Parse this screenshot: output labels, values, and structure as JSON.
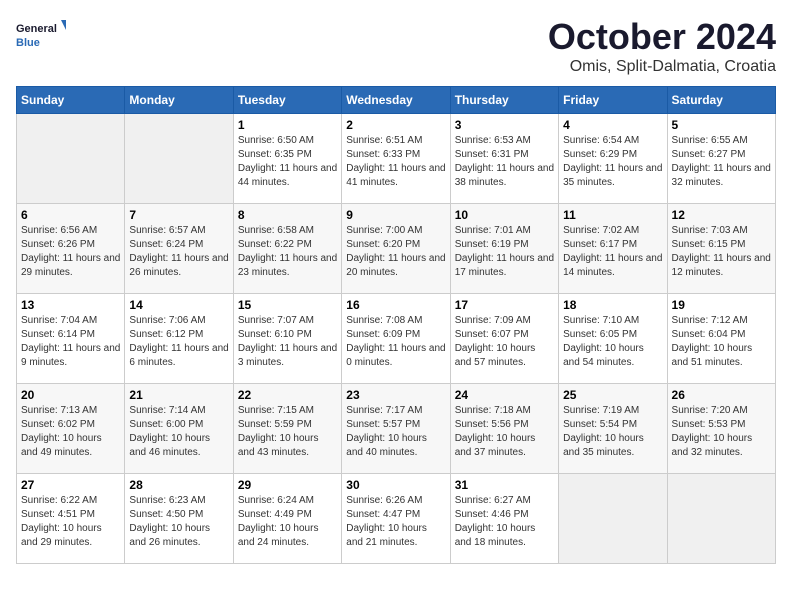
{
  "header": {
    "logo_line1": "General",
    "logo_line2": "Blue",
    "month": "October 2024",
    "location": "Omis, Split-Dalmatia, Croatia"
  },
  "weekdays": [
    "Sunday",
    "Monday",
    "Tuesday",
    "Wednesday",
    "Thursday",
    "Friday",
    "Saturday"
  ],
  "weeks": [
    [
      {
        "day": "",
        "info": ""
      },
      {
        "day": "",
        "info": ""
      },
      {
        "day": "1",
        "sunrise": "6:50 AM",
        "sunset": "6:35 PM",
        "daylight": "11 hours and 44 minutes."
      },
      {
        "day": "2",
        "sunrise": "6:51 AM",
        "sunset": "6:33 PM",
        "daylight": "11 hours and 41 minutes."
      },
      {
        "day": "3",
        "sunrise": "6:53 AM",
        "sunset": "6:31 PM",
        "daylight": "11 hours and 38 minutes."
      },
      {
        "day": "4",
        "sunrise": "6:54 AM",
        "sunset": "6:29 PM",
        "daylight": "11 hours and 35 minutes."
      },
      {
        "day": "5",
        "sunrise": "6:55 AM",
        "sunset": "6:27 PM",
        "daylight": "11 hours and 32 minutes."
      }
    ],
    [
      {
        "day": "6",
        "sunrise": "6:56 AM",
        "sunset": "6:26 PM",
        "daylight": "11 hours and 29 minutes."
      },
      {
        "day": "7",
        "sunrise": "6:57 AM",
        "sunset": "6:24 PM",
        "daylight": "11 hours and 26 minutes."
      },
      {
        "day": "8",
        "sunrise": "6:58 AM",
        "sunset": "6:22 PM",
        "daylight": "11 hours and 23 minutes."
      },
      {
        "day": "9",
        "sunrise": "7:00 AM",
        "sunset": "6:20 PM",
        "daylight": "11 hours and 20 minutes."
      },
      {
        "day": "10",
        "sunrise": "7:01 AM",
        "sunset": "6:19 PM",
        "daylight": "11 hours and 17 minutes."
      },
      {
        "day": "11",
        "sunrise": "7:02 AM",
        "sunset": "6:17 PM",
        "daylight": "11 hours and 14 minutes."
      },
      {
        "day": "12",
        "sunrise": "7:03 AM",
        "sunset": "6:15 PM",
        "daylight": "11 hours and 12 minutes."
      }
    ],
    [
      {
        "day": "13",
        "sunrise": "7:04 AM",
        "sunset": "6:14 PM",
        "daylight": "11 hours and 9 minutes."
      },
      {
        "day": "14",
        "sunrise": "7:06 AM",
        "sunset": "6:12 PM",
        "daylight": "11 hours and 6 minutes."
      },
      {
        "day": "15",
        "sunrise": "7:07 AM",
        "sunset": "6:10 PM",
        "daylight": "11 hours and 3 minutes."
      },
      {
        "day": "16",
        "sunrise": "7:08 AM",
        "sunset": "6:09 PM",
        "daylight": "11 hours and 0 minutes."
      },
      {
        "day": "17",
        "sunrise": "7:09 AM",
        "sunset": "6:07 PM",
        "daylight": "10 hours and 57 minutes."
      },
      {
        "day": "18",
        "sunrise": "7:10 AM",
        "sunset": "6:05 PM",
        "daylight": "10 hours and 54 minutes."
      },
      {
        "day": "19",
        "sunrise": "7:12 AM",
        "sunset": "6:04 PM",
        "daylight": "10 hours and 51 minutes."
      }
    ],
    [
      {
        "day": "20",
        "sunrise": "7:13 AM",
        "sunset": "6:02 PM",
        "daylight": "10 hours and 49 minutes."
      },
      {
        "day": "21",
        "sunrise": "7:14 AM",
        "sunset": "6:00 PM",
        "daylight": "10 hours and 46 minutes."
      },
      {
        "day": "22",
        "sunrise": "7:15 AM",
        "sunset": "5:59 PM",
        "daylight": "10 hours and 43 minutes."
      },
      {
        "day": "23",
        "sunrise": "7:17 AM",
        "sunset": "5:57 PM",
        "daylight": "10 hours and 40 minutes."
      },
      {
        "day": "24",
        "sunrise": "7:18 AM",
        "sunset": "5:56 PM",
        "daylight": "10 hours and 37 minutes."
      },
      {
        "day": "25",
        "sunrise": "7:19 AM",
        "sunset": "5:54 PM",
        "daylight": "10 hours and 35 minutes."
      },
      {
        "day": "26",
        "sunrise": "7:20 AM",
        "sunset": "5:53 PM",
        "daylight": "10 hours and 32 minutes."
      }
    ],
    [
      {
        "day": "27",
        "sunrise": "6:22 AM",
        "sunset": "4:51 PM",
        "daylight": "10 hours and 29 minutes."
      },
      {
        "day": "28",
        "sunrise": "6:23 AM",
        "sunset": "4:50 PM",
        "daylight": "10 hours and 26 minutes."
      },
      {
        "day": "29",
        "sunrise": "6:24 AM",
        "sunset": "4:49 PM",
        "daylight": "10 hours and 24 minutes."
      },
      {
        "day": "30",
        "sunrise": "6:26 AM",
        "sunset": "4:47 PM",
        "daylight": "10 hours and 21 minutes."
      },
      {
        "day": "31",
        "sunrise": "6:27 AM",
        "sunset": "4:46 PM",
        "daylight": "10 hours and 18 minutes."
      },
      {
        "day": "",
        "info": ""
      },
      {
        "day": "",
        "info": ""
      }
    ]
  ],
  "labels": {
    "sunrise_prefix": "Sunrise: ",
    "sunset_prefix": "Sunset: ",
    "daylight_prefix": "Daylight: "
  }
}
